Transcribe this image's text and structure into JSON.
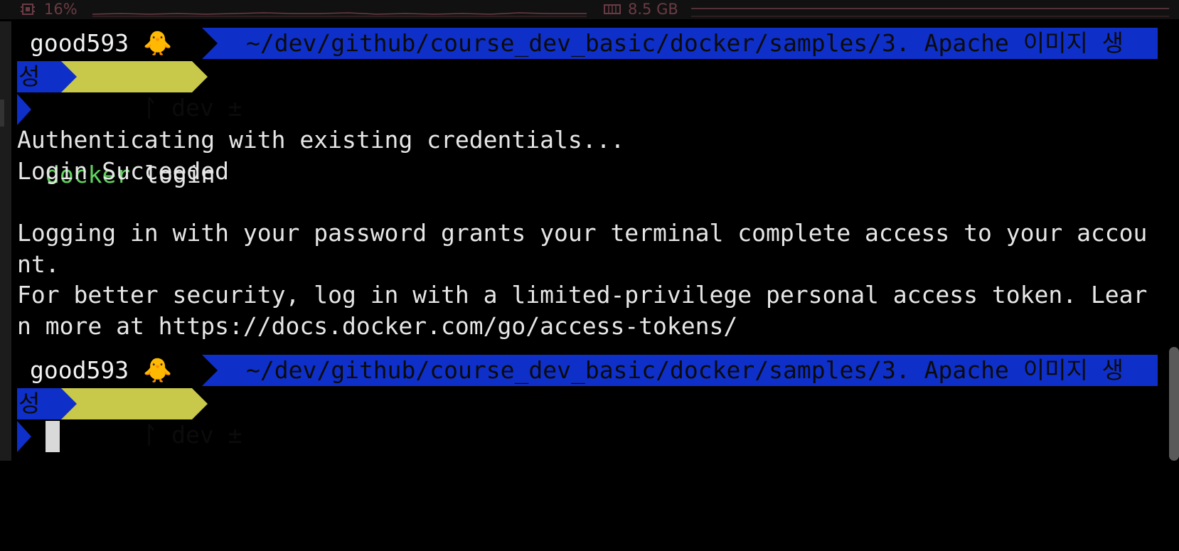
{
  "statusbar": {
    "cpu_icon": "cpu-chip-icon",
    "cpu_percent": "16%",
    "mem_icon": "memory-icon",
    "mem_used": "8.5 GB",
    "accent": "#6b3b45"
  },
  "prompt": {
    "user": "good593",
    "user_emoji": "🐥",
    "path_line1": "~/dev/github/course_dev_basic/docker/samples/3. Apache 이미지 생",
    "path_line2": "성",
    "branch_icon": "git-branch-icon",
    "branch": "dev ±",
    "path_color": "#0f2fc9",
    "git_color": "#c8c84a"
  },
  "command": {
    "prompt_icon": "chevron-right-icon",
    "program": "docker",
    "args": "login"
  },
  "output": [
    "Authenticating with existing credentials...",
    "Login Succeeded",
    "",
    "Logging in with your password grants your terminal complete access to your accou",
    "nt.",
    "For better security, log in with a limited-privilege personal access token. Lear",
    "n more at https://docs.docker.com/go/access-tokens/"
  ]
}
